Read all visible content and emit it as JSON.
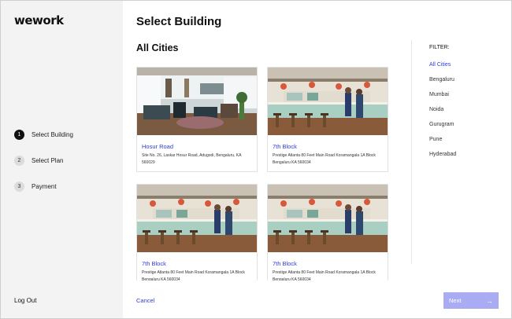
{
  "brand": {
    "logo_text": "wework"
  },
  "steps": [
    {
      "number": "1",
      "label": "Select Building",
      "active": true
    },
    {
      "number": "2",
      "label": "Select Plan",
      "active": false
    },
    {
      "number": "3",
      "label": "Payment",
      "active": false
    }
  ],
  "sidebar": {
    "logout_label": "Log Out"
  },
  "header": {
    "title": "Select Building"
  },
  "main": {
    "section_title": "All Cities"
  },
  "buildings": [
    {
      "name": "Hosur Road",
      "address": "Site No. 26, Laskar Hosur Road, Adugodi, Bengaluru, KA 560029",
      "photo": "office-lounge"
    },
    {
      "name": "7th Block",
      "address": "Prestige Atlanta 80 Feet Main Road Koramangala 1A Block Bengaluru KA 560034",
      "photo": "cafe-counter"
    },
    {
      "name": "7th Block",
      "address": "Prestige Atlanta 80 Feet Main Road Koramangala 1A Block Bengaluru KA 560034",
      "photo": "cafe-counter"
    },
    {
      "name": "7th Block",
      "address": "Prestige Atlanta 80 Feet Main Road Koramangala 1A Block Bengaluru KA 560034",
      "photo": "cafe-counter"
    }
  ],
  "filter": {
    "label": "FILTER:",
    "options": [
      "All Cities",
      "Bengaluru",
      "Mumbai",
      "Noida",
      "Gurugram",
      "Pune",
      "Hyderabad"
    ],
    "selected": "All Cities"
  },
  "footer": {
    "cancel_label": "Cancel",
    "next_label": "Next"
  },
  "colors": {
    "accent": "#2f3bd6",
    "next_button": "#a9acf3",
    "sidebar_bg": "#f3f3f3"
  }
}
